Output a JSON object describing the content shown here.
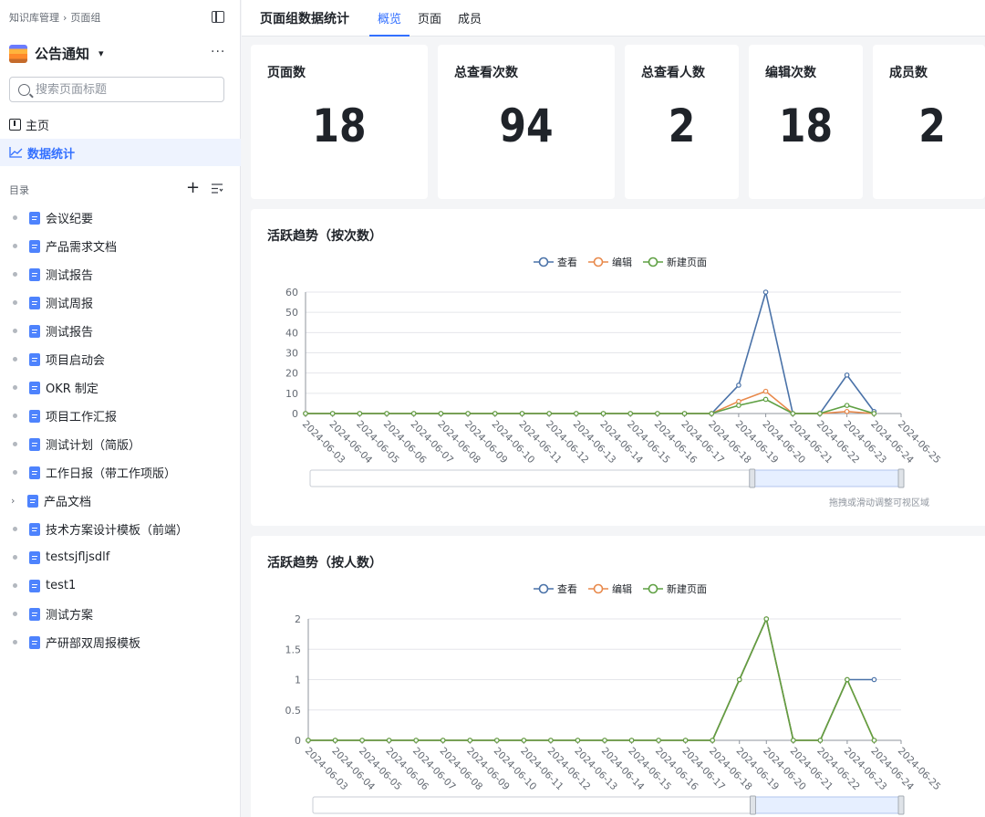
{
  "breadcrumb": {
    "root": "知识库管理",
    "separator": "›",
    "current": "页面组"
  },
  "space": {
    "name": "公告通知",
    "more": "···"
  },
  "search": {
    "placeholder": "搜索页面标题"
  },
  "nav": {
    "home": "主页",
    "stats": "数据统计"
  },
  "catalog": {
    "label": "目录",
    "add": "+"
  },
  "docs": [
    {
      "name": "会议纪要",
      "expandable": false
    },
    {
      "name": "产品需求文档",
      "expandable": false
    },
    {
      "name": "测试报告",
      "expandable": false
    },
    {
      "name": "测试周报",
      "expandable": false
    },
    {
      "name": "测试报告",
      "expandable": false
    },
    {
      "name": "项目启动会",
      "expandable": false
    },
    {
      "name": "OKR 制定",
      "expandable": false
    },
    {
      "name": "项目工作汇报",
      "expandable": false
    },
    {
      "name": "测试计划（简版）",
      "expandable": false
    },
    {
      "name": "工作日报（带工作项版）",
      "expandable": false
    },
    {
      "name": "产品文档",
      "expandable": true
    },
    {
      "name": "技术方案设计模板（前端）",
      "expandable": false
    },
    {
      "name": "testsjfljsdlf",
      "expandable": false
    },
    {
      "name": "test1",
      "expandable": false
    },
    {
      "name": "测试方案",
      "expandable": false
    },
    {
      "name": "产研部双周报模板",
      "expandable": false
    }
  ],
  "header": {
    "title": "页面组数据统计",
    "tabs": [
      "概览",
      "页面",
      "成员"
    ],
    "active_tab": "概览"
  },
  "stats": [
    {
      "label": "页面数",
      "value": "18"
    },
    {
      "label": "总查看次数",
      "value": "94"
    },
    {
      "label": "总查看人数",
      "value": "2"
    },
    {
      "label": "编辑次数",
      "value": "18"
    },
    {
      "label": "成员数",
      "value": "2"
    }
  ],
  "colors": {
    "accent": "#3370ff",
    "view": "#4a72a8",
    "edit": "#e8894b",
    "new_page": "#5fa043"
  },
  "hint": "拖拽或滑动调整可视区域",
  "chart_data": [
    {
      "type": "line",
      "title": "活跃趋势（按次数）",
      "x": [
        "2024-06-03",
        "2024-06-04",
        "2024-06-05",
        "2024-06-06",
        "2024-06-07",
        "2024-06-08",
        "2024-06-09",
        "2024-06-10",
        "2024-06-11",
        "2024-06-12",
        "2024-06-13",
        "2024-06-14",
        "2024-06-15",
        "2024-06-16",
        "2024-06-17",
        "2024-06-18",
        "2024-06-19",
        "2024-06-20",
        "2024-06-21",
        "2024-06-22",
        "2024-06-23",
        "2024-06-24",
        "2024-06-25"
      ],
      "series": [
        {
          "name": "查看",
          "color": "#4a72a8",
          "values": [
            0,
            0,
            0,
            0,
            0,
            0,
            0,
            0,
            0,
            0,
            0,
            0,
            0,
            0,
            0,
            0,
            14,
            60,
            0,
            0,
            19,
            1,
            null
          ]
        },
        {
          "name": "编辑",
          "color": "#e8894b",
          "values": [
            0,
            0,
            0,
            0,
            0,
            0,
            0,
            0,
            0,
            0,
            0,
            0,
            0,
            0,
            0,
            0,
            6,
            11,
            0,
            0,
            1,
            0,
            null
          ]
        },
        {
          "name": "新建页面",
          "color": "#5fa043",
          "values": [
            0,
            0,
            0,
            0,
            0,
            0,
            0,
            0,
            0,
            0,
            0,
            0,
            0,
            0,
            0,
            0,
            4,
            7,
            0,
            0,
            4,
            0,
            null
          ]
        }
      ],
      "ylim": [
        0,
        60
      ],
      "yticks": [
        0,
        10,
        20,
        30,
        40,
        50,
        60
      ],
      "grid": true,
      "legend": "top-center"
    },
    {
      "type": "line",
      "title": "活跃趋势（按人数）",
      "x": [
        "2024-06-03",
        "2024-06-04",
        "2024-06-05",
        "2024-06-06",
        "2024-06-07",
        "2024-06-08",
        "2024-06-09",
        "2024-06-10",
        "2024-06-11",
        "2024-06-12",
        "2024-06-13",
        "2024-06-14",
        "2024-06-15",
        "2024-06-16",
        "2024-06-17",
        "2024-06-18",
        "2024-06-19",
        "2024-06-20",
        "2024-06-21",
        "2024-06-22",
        "2024-06-23",
        "2024-06-24",
        "2024-06-25"
      ],
      "series": [
        {
          "name": "查看",
          "color": "#4a72a8",
          "values": [
            0,
            0,
            0,
            0,
            0,
            0,
            0,
            0,
            0,
            0,
            0,
            0,
            0,
            0,
            0,
            0,
            1,
            2,
            0,
            0,
            1,
            1,
            null
          ]
        },
        {
          "name": "编辑",
          "color": "#e8894b",
          "values": [
            0,
            0,
            0,
            0,
            0,
            0,
            0,
            0,
            0,
            0,
            0,
            0,
            0,
            0,
            0,
            0,
            1,
            2,
            0,
            0,
            1,
            0,
            null
          ]
        },
        {
          "name": "新建页面",
          "color": "#5fa043",
          "values": [
            0,
            0,
            0,
            0,
            0,
            0,
            0,
            0,
            0,
            0,
            0,
            0,
            0,
            0,
            0,
            0,
            1,
            2,
            0,
            0,
            1,
            0,
            null
          ]
        }
      ],
      "ylim": [
        0,
        2
      ],
      "yticks": [
        0,
        0.5,
        1,
        1.5,
        2
      ],
      "grid": true,
      "legend": "top-center"
    }
  ]
}
